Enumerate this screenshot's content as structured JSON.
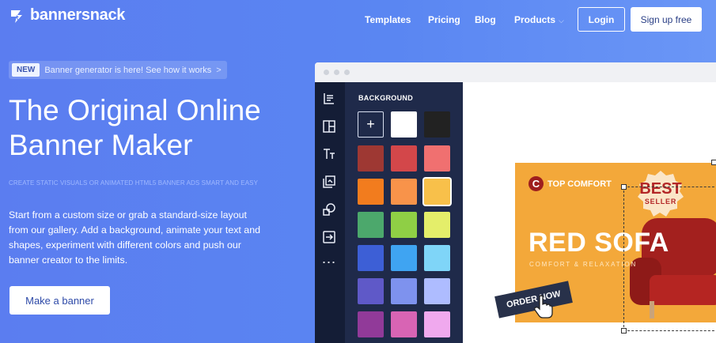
{
  "brand": {
    "name": "bannersnack"
  },
  "nav": {
    "links": [
      "Templates",
      "Pricing",
      "Blog",
      "Products"
    ],
    "login": "Login",
    "signup": "Sign up free"
  },
  "announcement": {
    "badge": "NEW",
    "text": "Banner generator is here! See how it works",
    "arrow": ">"
  },
  "hero": {
    "title_line1": "The Original Online",
    "title_line2": "Banner Maker",
    "subtitle": "CREATE STATIC VISUALS OR ANIMATED HTML5 BANNER ADS SMART AND EASY",
    "body": "Start from a custom size or grab a standard-size layout from our gallery. Add a background, animate your text and shapes, experiment with different colors and push our banner creator to the limits.",
    "cta": "Make a banner"
  },
  "editor": {
    "panel_title": "BACKGROUND",
    "tools": [
      "template-icon",
      "layout-icon",
      "text-icon",
      "media-icon",
      "shapes-icon",
      "export-icon",
      "more-icon"
    ],
    "more_glyph": "⋯",
    "swatches": [
      [
        "#ffffff",
        "#222222"
      ],
      [
        "#9e3833",
        "#d3474a",
        "#f07070"
      ],
      [
        "#f27c1e",
        "#f8934a",
        "#f8c04a"
      ],
      [
        "#4ca86c",
        "#8fcf45",
        "#e4ee6a"
      ],
      [
        "#3d5fd6",
        "#3fa4f2",
        "#7fd5f8"
      ],
      [
        "#5f59c8",
        "#7e92ee",
        "#aebcff"
      ],
      [
        "#913a99",
        "#d864b4",
        "#f0a9ee"
      ]
    ],
    "add_label": "+"
  },
  "banner": {
    "logo_letter": "C",
    "logo_text": "TOP COMFORT",
    "title": "RED SOFA",
    "subtitle": "COMFORT & RELAXATION",
    "seal_line1": "BEST",
    "seal_line2": "SELLER",
    "order_label": "ORDER NOW"
  }
}
